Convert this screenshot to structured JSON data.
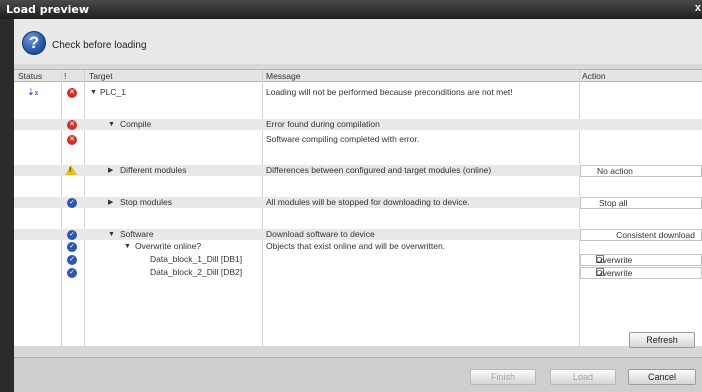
{
  "window": {
    "title": "Load preview",
    "close_glyph": "x"
  },
  "header": {
    "icon": "question-icon",
    "icon_glyph": "?",
    "text": "Check before loading"
  },
  "columns": {
    "status": "Status",
    "bang": "!",
    "target": "Target",
    "message": "Message",
    "action": "Action"
  },
  "rows": [
    {
      "target": "PLC_1",
      "message": "Loading will not be performed because preconditions are not met!",
      "action": ""
    },
    {
      "target": "Compile",
      "message": "Error found during compilation",
      "action": ""
    },
    {
      "target": "",
      "message": "Software compiling completed with error.",
      "action": ""
    },
    {
      "target": "Different modules",
      "message": "Differences between configured and target modules (online)",
      "action": "No action"
    },
    {
      "target": "Stop modules",
      "message": "All modules will be stopped for downloading to device.",
      "action": "Stop all"
    },
    {
      "target": "Software",
      "message": "Download software to device",
      "action": "Consistent download"
    },
    {
      "target": "Overwrite online?",
      "message": "Objects that exist online and will be overwritten.",
      "action": ""
    },
    {
      "target": "Data_block_1_Dill [DB1]",
      "message": "",
      "action": "Overwrite"
    },
    {
      "target": "Data_block_2_Dill [DB2]",
      "message": "",
      "action": "Overwrite"
    }
  ],
  "buttons": {
    "refresh": "Refresh",
    "finish": "Finish",
    "load": "Load",
    "cancel": "Cancel"
  },
  "colors": {
    "error": "#d0312d",
    "ok": "#2b57b0",
    "warning": "#e6c21c",
    "titlebar": "#1e1e1e"
  }
}
